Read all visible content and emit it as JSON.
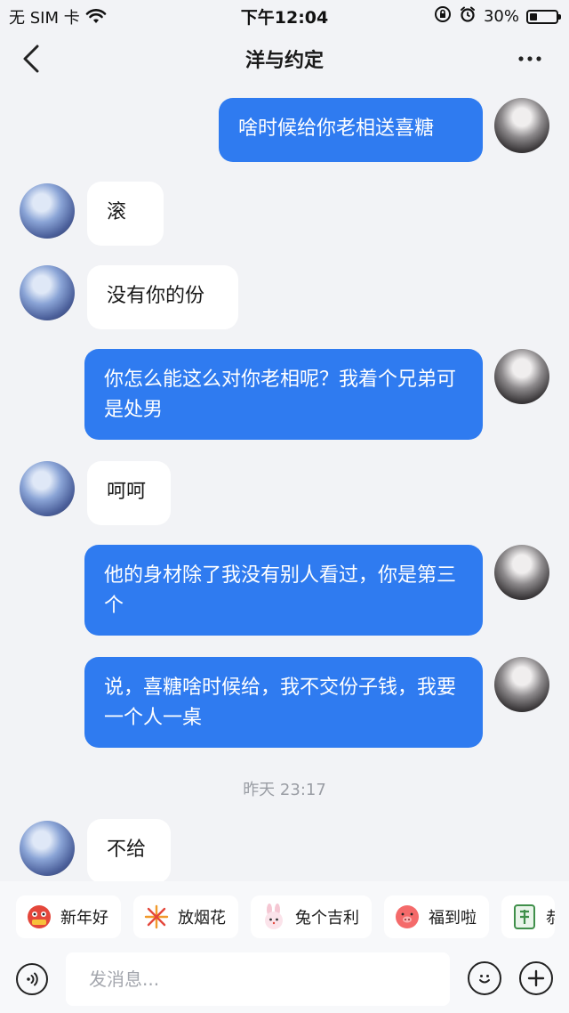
{
  "status_bar": {
    "carrier": "无 SIM 卡",
    "time": "下午12:04",
    "battery": "30%",
    "battery_level": 0.3
  },
  "nav": {
    "title": "洋与约定"
  },
  "messages": [
    {
      "side": "me",
      "text": "啥时候给你老相送喜糖"
    },
    {
      "side": "friend",
      "text": "滚"
    },
    {
      "side": "friend",
      "text": "没有你的份"
    },
    {
      "side": "me",
      "text": "你怎么能这么对你老相呢？我着个兄弟可是处男"
    },
    {
      "side": "friend",
      "text": "呵呵"
    },
    {
      "side": "me",
      "text": "他的身材除了我没有别人看过，你是第三个"
    },
    {
      "side": "me",
      "text": "说，喜糖啥时候给，我不交份子钱，我要一个人一桌"
    },
    {
      "side": "friend",
      "text": "不给"
    }
  ],
  "timestamp": "昨天 23:17",
  "quick_replies": [
    {
      "label": "新年好",
      "icon": "lion-dance-icon"
    },
    {
      "label": "放烟花",
      "icon": "fireworks-icon"
    },
    {
      "label": "兔个吉利",
      "icon": "rabbit-icon"
    },
    {
      "label": "福到啦",
      "icon": "fu-pig-icon"
    },
    {
      "label": "恭",
      "icon": "mahjong-icon"
    }
  ],
  "input": {
    "placeholder": "发消息..."
  },
  "colors": {
    "background": "#f2f3f6",
    "my_bubble": "#2f7bf0",
    "friend_bubble": "#ffffff"
  }
}
